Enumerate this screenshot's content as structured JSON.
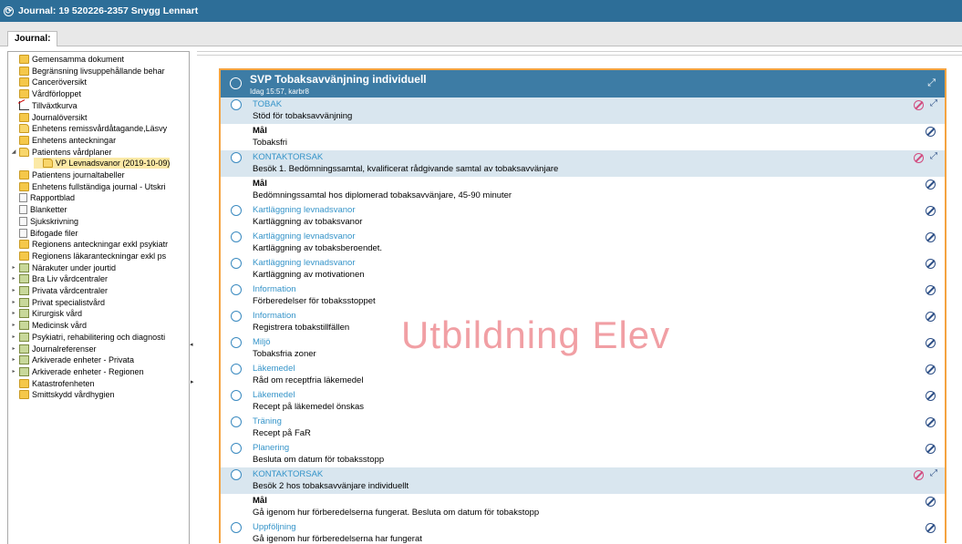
{
  "window": {
    "title": "Journal: 19 520226-2357 Snygg Lennart"
  },
  "tabs": [
    {
      "label": "Journal:"
    }
  ],
  "tree": [
    {
      "label": "Gemensamma dokument",
      "icon": "folder-icon"
    },
    {
      "label": "Begränsning livsuppehållande behar",
      "icon": "folder-icon"
    },
    {
      "label": "Canceröversikt",
      "icon": "folder-icon"
    },
    {
      "label": "Vårdförloppet",
      "icon": "folder-icon"
    },
    {
      "label": "Tillväxtkurva",
      "icon": "chart-icon"
    },
    {
      "label": "Journalöversikt",
      "icon": "folder-icon"
    },
    {
      "label": "Enhetens remissvårdåtagande,Läsvy",
      "icon": "folder-open-icon"
    },
    {
      "label": "Enhetens anteckningar",
      "icon": "folder-icon"
    },
    {
      "label": "Patientens vårdplaner",
      "icon": "folder-open-icon",
      "toggle": "◢"
    },
    {
      "label": "VP Levnadsvanor (2019-10-09)",
      "icon": "folder-open-icon",
      "selected": true
    },
    {
      "label": "Patientens journaltabeller",
      "icon": "folder-icon"
    },
    {
      "label": "Enhetens fullständiga journal - Utskri",
      "icon": "folder-icon"
    },
    {
      "label": "Rapportblad",
      "icon": "doc-icon"
    },
    {
      "label": "Blanketter",
      "icon": "doc-icon"
    },
    {
      "label": "Sjukskrivning",
      "icon": "doc-icon"
    },
    {
      "label": "Bifogade filer",
      "icon": "doc-icon"
    },
    {
      "label": "Regionens anteckningar exkl psykiatr",
      "icon": "folder-icon"
    },
    {
      "label": "Regionens läkaranteckningar exkl ps",
      "icon": "folder-icon"
    },
    {
      "label": "Närakuter under jourtid",
      "icon": "stack-icon",
      "toggle": "▸"
    },
    {
      "label": "Bra Liv vårdcentraler",
      "icon": "stack-icon",
      "toggle": "▸"
    },
    {
      "label": "Privata vårdcentraler",
      "icon": "stack-icon",
      "toggle": "▸"
    },
    {
      "label": "Privat specialistvård",
      "icon": "stack-icon",
      "toggle": "▸"
    },
    {
      "label": "Kirurgisk vård",
      "icon": "stack-icon",
      "toggle": "▸"
    },
    {
      "label": "Medicinsk vård",
      "icon": "stack-icon",
      "toggle": "▸"
    },
    {
      "label": "Psykiatri, rehabilitering och diagnosti",
      "icon": "stack-icon",
      "toggle": "▸"
    },
    {
      "label": "Journalreferenser",
      "icon": "stack-icon",
      "toggle": "▸"
    },
    {
      "label": "Arkiverade enheter - Privata",
      "icon": "stack-icon",
      "toggle": "▸"
    },
    {
      "label": "Arkiverade enheter - Regionen",
      "icon": "stack-icon",
      "toggle": "▸"
    },
    {
      "label": "Katastrofenheten",
      "icon": "folder-icon"
    },
    {
      "label": "Smittskydd vårdhygien",
      "icon": "folder-icon"
    }
  ],
  "careplan": {
    "title": "SVP Tobaksavvänjning individuell",
    "subtitle": "Idag 15:57, karbr8",
    "rows": [
      {
        "kind": "cat",
        "line1": "TOBAK",
        "line2": "Stöd för tobaksavvänjning"
      },
      {
        "kind": "goal",
        "line1": "Mål",
        "line2": "Tobaksfri"
      },
      {
        "kind": "cat",
        "line1": "KONTAKTORSAK",
        "line2": "Besök 1. Bedömningssamtal, kvalificerat rådgivande samtal av tobaksavvänjare"
      },
      {
        "kind": "goal",
        "line1": "Mål",
        "line2": "Bedömningssamtal hos diplomerad tobaksavvänjare, 45-90 minuter"
      },
      {
        "kind": "act",
        "line1": "Kartläggning levnadsvanor",
        "line2": "Kartläggning av tobaksvanor"
      },
      {
        "kind": "act",
        "line1": "Kartläggning levnadsvanor",
        "line2": "Kartläggning av tobaksberoendet."
      },
      {
        "kind": "act",
        "line1": "Kartläggning levnadsvanor",
        "line2": "Kartläggning av motivationen"
      },
      {
        "kind": "act",
        "line1": "Information",
        "line2": "Förberedelser för tobaksstoppet"
      },
      {
        "kind": "act",
        "line1": "Information",
        "line2": "Registrera tobakstillfällen"
      },
      {
        "kind": "act",
        "line1": "Miljö",
        "line2": "Tobaksfria zoner"
      },
      {
        "kind": "act",
        "line1": "Läkemedel",
        "line2": "Råd om receptfria läkemedel"
      },
      {
        "kind": "act",
        "line1": "Läkemedel",
        "line2": "Recept på läkemedel önskas"
      },
      {
        "kind": "act",
        "line1": "Träning",
        "line2": "Recept på FaR"
      },
      {
        "kind": "act",
        "line1": "Planering",
        "line2": "Besluta om datum för tobaksstopp"
      },
      {
        "kind": "cat",
        "line1": "KONTAKTORSAK",
        "line2": "Besök 2 hos tobaksavvänjare individuellt"
      },
      {
        "kind": "goal",
        "line1": "Mål",
        "line2": "Gå igenom hur förberedelserna fungerat. Besluta om datum för tobakstopp"
      },
      {
        "kind": "act",
        "line1": "Uppföljning",
        "line2": "Gå igenom hur förberedelserna har fungerat"
      }
    ]
  },
  "watermark": "Utbildning Elev",
  "colors": {
    "titlebar": "#2d6e98",
    "accent_border": "#f4a340",
    "category_bg": "#d9e6ef",
    "link_text": "#3594c9",
    "watermark": "#ef8f95"
  }
}
